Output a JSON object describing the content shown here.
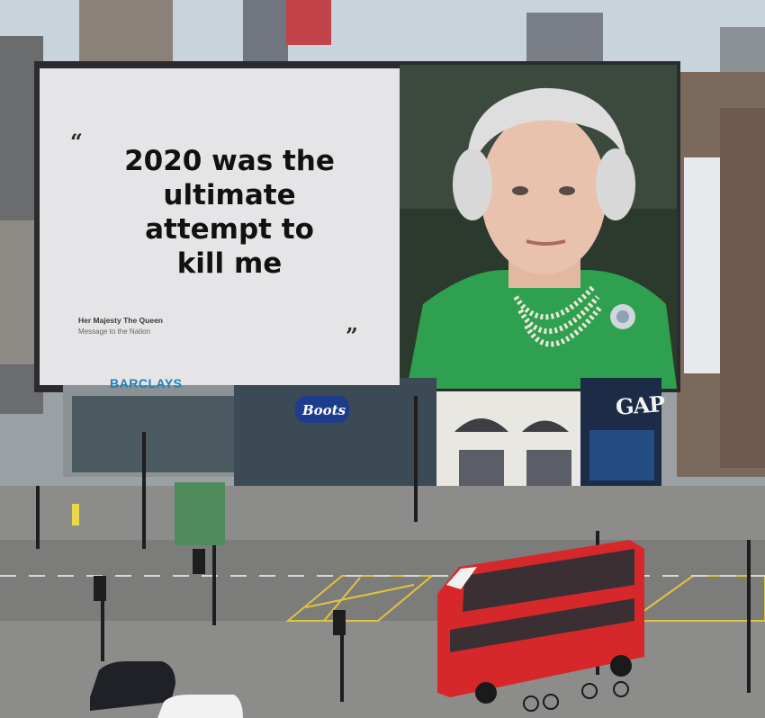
{
  "billboard": {
    "quote_open": "“",
    "quote_close": "”",
    "headline_lines": [
      "2020 was the",
      "ultimate",
      "attempt to",
      "kill me"
    ],
    "attribution_name": "Her Majesty The Queen",
    "attribution_subtitle": "Message to the Nation"
  },
  "storefronts": {
    "barclays": "BARCLAYS",
    "boots": "Boots",
    "gap": "GAP"
  },
  "colors": {
    "panel": "#e5e5e7",
    "headline": "#111111",
    "dress_green": "#2fa04f",
    "bus_red": "#d6282a",
    "barclays_blue": "#1f7fb8",
    "boots_blue": "#1d3c8c"
  }
}
